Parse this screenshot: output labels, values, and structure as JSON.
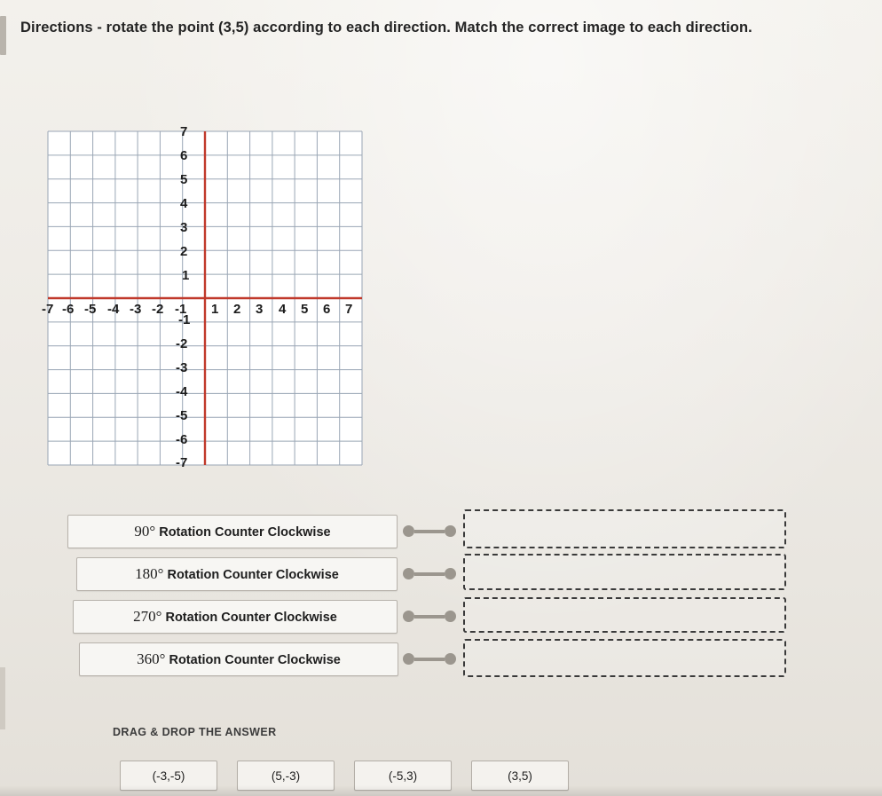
{
  "directions": "Directions - rotate the point (3,5) according to each direction.  Match the correct image to each direction.",
  "graph": {
    "x_ticks": [
      "-7",
      "-6",
      "-5",
      "-4",
      "-3",
      "-2",
      "-1",
      "1",
      "2",
      "3",
      "4",
      "5",
      "6",
      "7"
    ],
    "y_ticks": [
      "7",
      "6",
      "5",
      "4",
      "3",
      "2",
      "1",
      "-1",
      "-2",
      "-3",
      "-4",
      "-5",
      "-6",
      "-7"
    ],
    "axis_color": "#c0392b",
    "grid_color": "#9aa6b5",
    "xmin": -7,
    "xmax": 7,
    "ymin": -7,
    "ymax": 7
  },
  "matches": [
    {
      "degree": "90°",
      "label": "Rotation Counter Clockwise",
      "answer": ""
    },
    {
      "degree": "180°",
      "label": "Rotation Counter Clockwise",
      "answer": ""
    },
    {
      "degree": "270°",
      "label": "Rotation Counter Clockwise",
      "answer": ""
    },
    {
      "degree": "360°",
      "label": "Rotation Counter Clockwise",
      "answer": ""
    }
  ],
  "drag_drop": {
    "heading": "DRAG & DROP THE ANSWER",
    "options": [
      "(-3,-5)",
      "(5,-3)",
      "(-5,3)",
      "(3,5)"
    ]
  }
}
